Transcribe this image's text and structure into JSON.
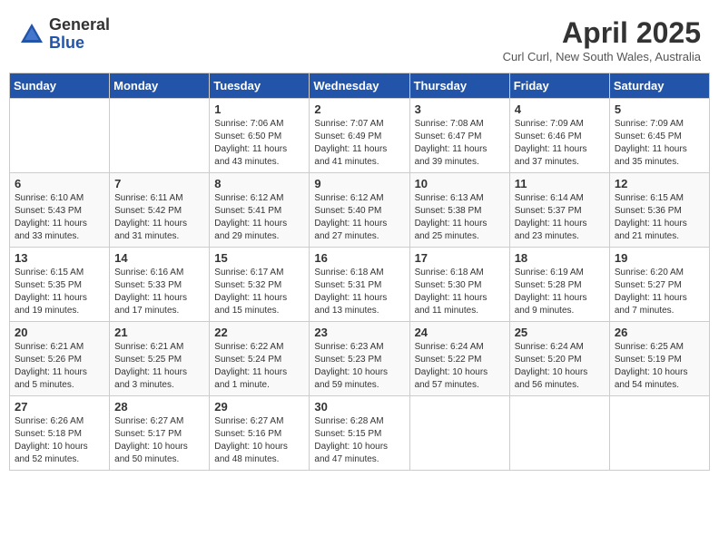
{
  "header": {
    "logo_general": "General",
    "logo_blue": "Blue",
    "month_title": "April 2025",
    "subtitle": "Curl Curl, New South Wales, Australia"
  },
  "weekdays": [
    "Sunday",
    "Monday",
    "Tuesday",
    "Wednesday",
    "Thursday",
    "Friday",
    "Saturday"
  ],
  "weeks": [
    [
      {
        "day": "",
        "sunrise": "",
        "sunset": "",
        "daylight": ""
      },
      {
        "day": "",
        "sunrise": "",
        "sunset": "",
        "daylight": ""
      },
      {
        "day": "1",
        "sunrise": "Sunrise: 7:06 AM",
        "sunset": "Sunset: 6:50 PM",
        "daylight": "Daylight: 11 hours and 43 minutes."
      },
      {
        "day": "2",
        "sunrise": "Sunrise: 7:07 AM",
        "sunset": "Sunset: 6:49 PM",
        "daylight": "Daylight: 11 hours and 41 minutes."
      },
      {
        "day": "3",
        "sunrise": "Sunrise: 7:08 AM",
        "sunset": "Sunset: 6:47 PM",
        "daylight": "Daylight: 11 hours and 39 minutes."
      },
      {
        "day": "4",
        "sunrise": "Sunrise: 7:09 AM",
        "sunset": "Sunset: 6:46 PM",
        "daylight": "Daylight: 11 hours and 37 minutes."
      },
      {
        "day": "5",
        "sunrise": "Sunrise: 7:09 AM",
        "sunset": "Sunset: 6:45 PM",
        "daylight": "Daylight: 11 hours and 35 minutes."
      }
    ],
    [
      {
        "day": "6",
        "sunrise": "Sunrise: 6:10 AM",
        "sunset": "Sunset: 5:43 PM",
        "daylight": "Daylight: 11 hours and 33 minutes."
      },
      {
        "day": "7",
        "sunrise": "Sunrise: 6:11 AM",
        "sunset": "Sunset: 5:42 PM",
        "daylight": "Daylight: 11 hours and 31 minutes."
      },
      {
        "day": "8",
        "sunrise": "Sunrise: 6:12 AM",
        "sunset": "Sunset: 5:41 PM",
        "daylight": "Daylight: 11 hours and 29 minutes."
      },
      {
        "day": "9",
        "sunrise": "Sunrise: 6:12 AM",
        "sunset": "Sunset: 5:40 PM",
        "daylight": "Daylight: 11 hours and 27 minutes."
      },
      {
        "day": "10",
        "sunrise": "Sunrise: 6:13 AM",
        "sunset": "Sunset: 5:38 PM",
        "daylight": "Daylight: 11 hours and 25 minutes."
      },
      {
        "day": "11",
        "sunrise": "Sunrise: 6:14 AM",
        "sunset": "Sunset: 5:37 PM",
        "daylight": "Daylight: 11 hours and 23 minutes."
      },
      {
        "day": "12",
        "sunrise": "Sunrise: 6:15 AM",
        "sunset": "Sunset: 5:36 PM",
        "daylight": "Daylight: 11 hours and 21 minutes."
      }
    ],
    [
      {
        "day": "13",
        "sunrise": "Sunrise: 6:15 AM",
        "sunset": "Sunset: 5:35 PM",
        "daylight": "Daylight: 11 hours and 19 minutes."
      },
      {
        "day": "14",
        "sunrise": "Sunrise: 6:16 AM",
        "sunset": "Sunset: 5:33 PM",
        "daylight": "Daylight: 11 hours and 17 minutes."
      },
      {
        "day": "15",
        "sunrise": "Sunrise: 6:17 AM",
        "sunset": "Sunset: 5:32 PM",
        "daylight": "Daylight: 11 hours and 15 minutes."
      },
      {
        "day": "16",
        "sunrise": "Sunrise: 6:18 AM",
        "sunset": "Sunset: 5:31 PM",
        "daylight": "Daylight: 11 hours and 13 minutes."
      },
      {
        "day": "17",
        "sunrise": "Sunrise: 6:18 AM",
        "sunset": "Sunset: 5:30 PM",
        "daylight": "Daylight: 11 hours and 11 minutes."
      },
      {
        "day": "18",
        "sunrise": "Sunrise: 6:19 AM",
        "sunset": "Sunset: 5:28 PM",
        "daylight": "Daylight: 11 hours and 9 minutes."
      },
      {
        "day": "19",
        "sunrise": "Sunrise: 6:20 AM",
        "sunset": "Sunset: 5:27 PM",
        "daylight": "Daylight: 11 hours and 7 minutes."
      }
    ],
    [
      {
        "day": "20",
        "sunrise": "Sunrise: 6:21 AM",
        "sunset": "Sunset: 5:26 PM",
        "daylight": "Daylight: 11 hours and 5 minutes."
      },
      {
        "day": "21",
        "sunrise": "Sunrise: 6:21 AM",
        "sunset": "Sunset: 5:25 PM",
        "daylight": "Daylight: 11 hours and 3 minutes."
      },
      {
        "day": "22",
        "sunrise": "Sunrise: 6:22 AM",
        "sunset": "Sunset: 5:24 PM",
        "daylight": "Daylight: 11 hours and 1 minute."
      },
      {
        "day": "23",
        "sunrise": "Sunrise: 6:23 AM",
        "sunset": "Sunset: 5:23 PM",
        "daylight": "Daylight: 10 hours and 59 minutes."
      },
      {
        "day": "24",
        "sunrise": "Sunrise: 6:24 AM",
        "sunset": "Sunset: 5:22 PM",
        "daylight": "Daylight: 10 hours and 57 minutes."
      },
      {
        "day": "25",
        "sunrise": "Sunrise: 6:24 AM",
        "sunset": "Sunset: 5:20 PM",
        "daylight": "Daylight: 10 hours and 56 minutes."
      },
      {
        "day": "26",
        "sunrise": "Sunrise: 6:25 AM",
        "sunset": "Sunset: 5:19 PM",
        "daylight": "Daylight: 10 hours and 54 minutes."
      }
    ],
    [
      {
        "day": "27",
        "sunrise": "Sunrise: 6:26 AM",
        "sunset": "Sunset: 5:18 PM",
        "daylight": "Daylight: 10 hours and 52 minutes."
      },
      {
        "day": "28",
        "sunrise": "Sunrise: 6:27 AM",
        "sunset": "Sunset: 5:17 PM",
        "daylight": "Daylight: 10 hours and 50 minutes."
      },
      {
        "day": "29",
        "sunrise": "Sunrise: 6:27 AM",
        "sunset": "Sunset: 5:16 PM",
        "daylight": "Daylight: 10 hours and 48 minutes."
      },
      {
        "day": "30",
        "sunrise": "Sunrise: 6:28 AM",
        "sunset": "Sunset: 5:15 PM",
        "daylight": "Daylight: 10 hours and 47 minutes."
      },
      {
        "day": "",
        "sunrise": "",
        "sunset": "",
        "daylight": ""
      },
      {
        "day": "",
        "sunrise": "",
        "sunset": "",
        "daylight": ""
      },
      {
        "day": "",
        "sunrise": "",
        "sunset": "",
        "daylight": ""
      }
    ]
  ]
}
